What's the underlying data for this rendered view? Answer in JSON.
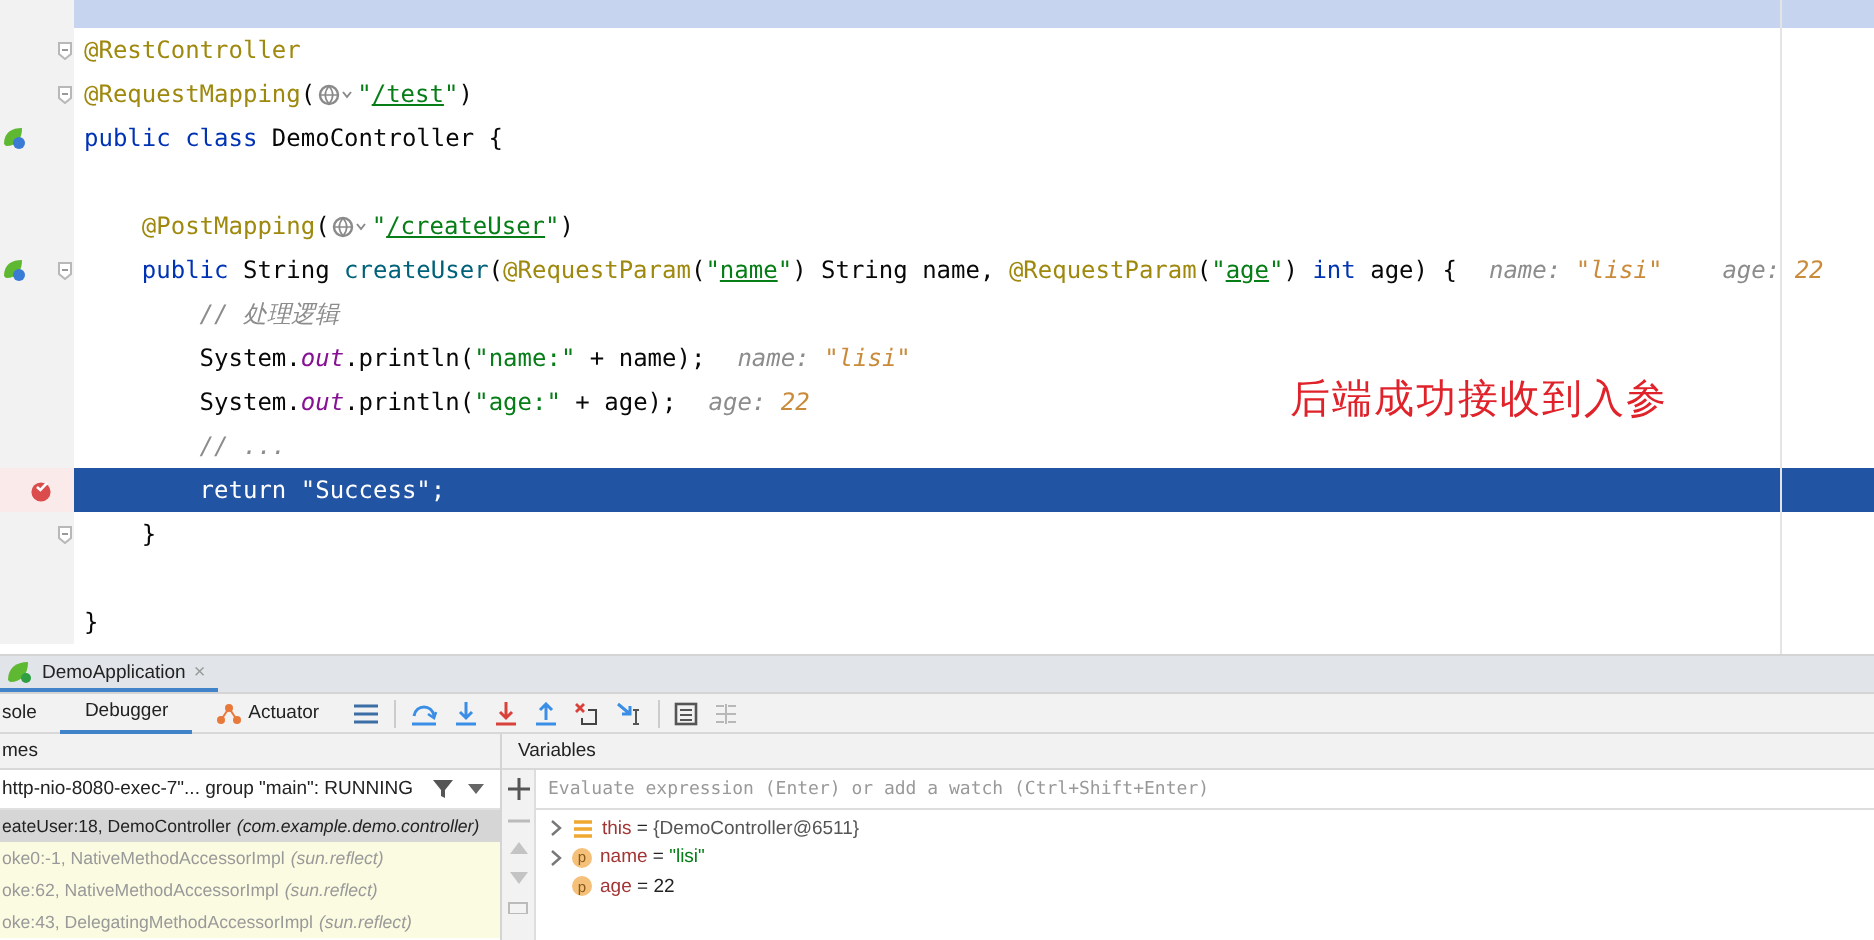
{
  "editor": {
    "lines": [
      {
        "selected": true
      },
      {
        "fold": true,
        "parts": [
          {
            "kind": "code",
            "tokens": [
              {
                "kind": "annotation",
                "text": "@RestController"
              }
            ]
          }
        ]
      },
      {
        "fold": true,
        "parts": [
          {
            "kind": "code",
            "tokens": [
              {
                "kind": "annotation",
                "text": "@RequestMapping"
              },
              {
                "kind": "plain",
                "text": "("
              }
            ]
          },
          {
            "kind": "globe"
          },
          {
            "kind": "code",
            "tokens": [
              {
                "kind": "string",
                "text": "\""
              },
              {
                "kind": "url",
                "text": "/test"
              },
              {
                "kind": "string",
                "text": "\""
              },
              {
                "kind": "plain",
                "text": ")"
              }
            ]
          }
        ]
      },
      {
        "run_marker": true,
        "parts": [
          {
            "kind": "code",
            "tokens": [
              {
                "kind": "keyword",
                "text": "public class "
              },
              {
                "kind": "plain",
                "text": "DemoController {"
              }
            ]
          }
        ],
        "children": [
          {
            "fold": false
          },
          {
            "parts": [
              {
                "kind": "code",
                "tokens": [
                  {
                    "kind": "annotation",
                    "text": "@PostMapping"
                  },
                  {
                    "kind": "plain",
                    "text": "("
                  }
                ]
              },
              {
                "kind": "globe"
              },
              {
                "kind": "code",
                "tokens": [
                  {
                    "kind": "string",
                    "text": "\""
                  },
                  {
                    "kind": "url",
                    "text": "/createUser"
                  },
                  {
                    "kind": "string",
                    "text": "\""
                  },
                  {
                    "kind": "plain",
                    "text": ")"
                  }
                ]
              }
            ]
          },
          {
            "run_marker": true,
            "fold": true,
            "parts": [
              {
                "kind": "code",
                "tokens": [
                  {
                    "kind": "keyword",
                    "text": "public "
                  },
                  {
                    "kind": "plain",
                    "text": "String "
                  },
                  {
                    "kind": "method",
                    "text": "createUser"
                  },
                  {
                    "kind": "plain",
                    "text": "("
                  },
                  {
                    "kind": "annotation",
                    "text": "@RequestParam"
                  },
                  {
                    "kind": "plain",
                    "text": "("
                  },
                  {
                    "kind": "string",
                    "text": "\""
                  },
                  {
                    "kind": "url",
                    "text": "name"
                  },
                  {
                    "kind": "string",
                    "text": "\""
                  },
                  {
                    "kind": "plain",
                    "text": ") String name, "
                  },
                  {
                    "kind": "annotation",
                    "text": "@RequestParam"
                  },
                  {
                    "kind": "plain",
                    "text": "("
                  },
                  {
                    "kind": "string",
                    "text": "\""
                  },
                  {
                    "kind": "url",
                    "text": "age"
                  },
                  {
                    "kind": "string",
                    "text": "\""
                  },
                  {
                    "kind": "plain",
                    "text": ") "
                  },
                  {
                    "kind": "keyword",
                    "text": "int "
                  },
                  {
                    "kind": "plain",
                    "text": "age) {"
                  }
                ]
              },
              {
                "kind": "hint",
                "label": "name:",
                "value": "\"lisi\""
              },
              {
                "kind": "hint",
                "label": "age:",
                "value": "22"
              }
            ],
            "children": [
              {
                "parts": [
                  {
                    "kind": "code",
                    "tokens": [
                      {
                        "kind": "comment",
                        "text": "// 处理逻辑"
                      }
                    ]
                  }
                ]
              },
              {
                "parts": [
                  {
                    "kind": "code",
                    "tokens": [
                      {
                        "kind": "plain",
                        "text": "System."
                      },
                      {
                        "kind": "field",
                        "text": "out"
                      },
                      {
                        "kind": "plain",
                        "text": ".println("
                      },
                      {
                        "kind": "string",
                        "text": "\"name:\""
                      },
                      {
                        "kind": "plain",
                        "text": " + name);"
                      }
                    ]
                  },
                  {
                    "kind": "hint",
                    "label": "name:",
                    "value": "\"lisi\""
                  }
                ]
              },
              {
                "parts": [
                  {
                    "kind": "code",
                    "tokens": [
                      {
                        "kind": "plain",
                        "text": "System."
                      },
                      {
                        "kind": "field",
                        "text": "out"
                      },
                      {
                        "kind": "plain",
                        "text": ".println("
                      },
                      {
                        "kind": "string",
                        "text": "\"age:\""
                      },
                      {
                        "kind": "plain",
                        "text": " + age);"
                      }
                    ]
                  },
                  {
                    "kind": "hint",
                    "label": "age:",
                    "value": "22"
                  }
                ]
              },
              {
                "parts": [
                  {
                    "kind": "code",
                    "tokens": [
                      {
                        "kind": "comment",
                        "text": "// ..."
                      }
                    ]
                  }
                ]
              },
              {
                "breakpoint": true,
                "execution_point": true,
                "parts": [
                  {
                    "kind": "code",
                    "tokens": [
                      {
                        "kind": "keyword",
                        "text": "return "
                      },
                      {
                        "kind": "string",
                        "text": "\"Success\""
                      },
                      {
                        "kind": "plain",
                        "text": ";"
                      }
                    ]
                  }
                ]
              }
            ]
          },
          {
            "fold": true,
            "parts": [
              {
                "kind": "code",
                "tokens": [
                  {
                    "kind": "plain",
                    "text": "}"
                  }
                ]
              }
            ]
          },
          {
            "fold": false
          }
        ]
      },
      {
        "parts": [
          {
            "kind": "code",
            "tokens": [
              {
                "kind": "plain",
                "text": "}"
              }
            ]
          }
        ]
      }
    ],
    "annotation": "后端成功接收到入参"
  },
  "run_tab": {
    "title": "DemoApplication",
    "close": "×",
    "selected": true
  },
  "tabs": [
    {
      "label": "sole",
      "kind": "plain",
      "selected": false
    },
    {
      "label": "Debugger",
      "kind": "plain",
      "selected": true
    },
    {
      "label": "Actuator",
      "kind": "actuator",
      "selected": false
    }
  ],
  "frames": {
    "header": "mes",
    "thread": "http-nio-8080-exec-7\"... group \"main\": RUNNING",
    "items": [
      {
        "method": "eateUser:18, DemoController",
        "package": "(com.example.demo.controller)",
        "selected": true,
        "library": false
      },
      {
        "method": "oke0:-1, NativeMethodAccessorImpl",
        "package": "(sun.reflect)",
        "selected": false,
        "library": true
      },
      {
        "method": "oke:62, NativeMethodAccessorImpl",
        "package": "(sun.reflect)",
        "selected": false,
        "library": true
      },
      {
        "method": "oke:43, DelegatingMethodAccessorImpl",
        "package": "(sun.reflect)",
        "selected": false,
        "library": true
      }
    ]
  },
  "variables": {
    "header": "Variables",
    "placeholder": "Evaluate expression (Enter) or add a watch (Ctrl+Shift+Enter)",
    "items": [
      {
        "name": "this",
        "operator": "=",
        "value": "{DemoController@6511}",
        "kind": "object",
        "expanded": false
      },
      {
        "name": "name",
        "operator": "=",
        "value": "\"lisi\"",
        "kind": "string",
        "badge": "p",
        "expanded": false
      },
      {
        "name": "age",
        "operator": "=",
        "value": "22",
        "kind": "number",
        "badge": "p"
      }
    ]
  }
}
